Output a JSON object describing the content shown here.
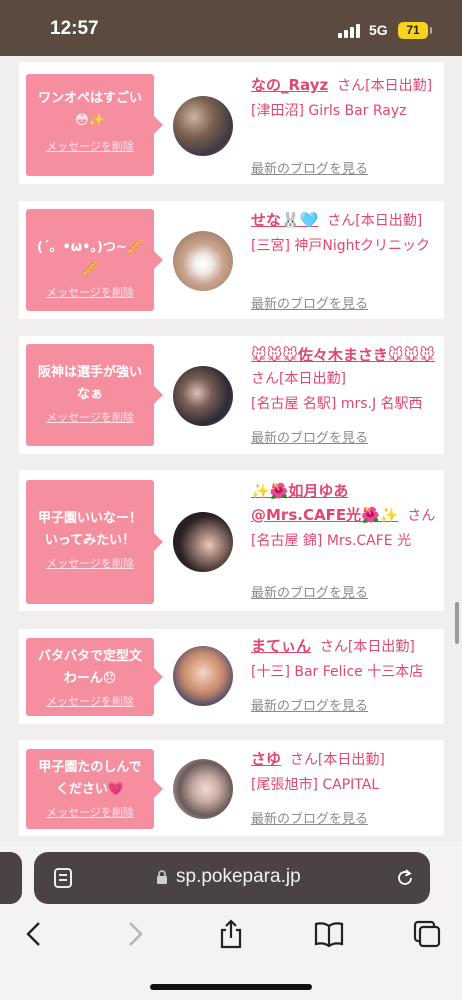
{
  "status": {
    "time": "12:57",
    "network": "5G",
    "battery": "71"
  },
  "cards": [
    {
      "message": "ワンオペはすごい😳✨",
      "delete_label": "メッセージを削除",
      "name": "なの_Rayz",
      "suffix": "さん[本日出勤]",
      "shop": "[津田沼] Girls Bar Rayz",
      "blog": "最新のブログを見る"
    },
    {
      "message": "(´。•ω•。)つ~🥖🥖",
      "delete_label": "メッセージを削除",
      "name": "せな🐰🩵",
      "suffix": "さん[本日出勤]",
      "shop": "[三宮] 神戸Nightクリニック",
      "blog": "最新のブログを見る"
    },
    {
      "message": "阪神は選手が強いなぁ",
      "delete_label": "メッセージを削除",
      "name": "🐭🐭🐭佐々木まさき🐭🐭🐭",
      "suffix": "さん[本日出勤]",
      "shop": "[名古屋 名駅] mrs.J 名駅西",
      "blog": "最新のブログを見る"
    },
    {
      "message": "甲子園いいなー！いってみたい！",
      "delete_label": "メッセージを削除",
      "name": "✨🌺如月ゆあ@Mrs.CAFE光🌺✨",
      "suffix": "さん",
      "shop": "[名古屋 錦] Mrs.CAFE 光",
      "blog": "最新のブログを見る"
    },
    {
      "message": "バタバタで定型文わーん😞",
      "delete_label": "メッセージを削除",
      "name": "まてぃん",
      "suffix": "さん[本日出勤]",
      "shop": "[十三] Bar Felice 十三本店",
      "blog": "最新のブログを見る"
    },
    {
      "message": "甲子園たのしんでください💗",
      "delete_label": "メッセージを削除",
      "name": "さゆ",
      "suffix": "さん[本日出勤]",
      "shop": "[尾張旭市] CAPITAL",
      "blog": "最新のブログを見る"
    }
  ],
  "browser": {
    "url": "sp.pokepara.jp"
  },
  "icons": {
    "tabs": "tab-overview-icon",
    "lock": "lock-icon",
    "reload": "reload-icon",
    "back": "chevron-left-icon",
    "forward": "chevron-right-icon",
    "share": "share-icon",
    "bookmarks": "book-icon",
    "tabs_toolbar": "tabs-icon"
  },
  "colors": {
    "bubble": "#f58fa0",
    "accent": "#e04771",
    "status_bar": "#5b4a3f"
  }
}
